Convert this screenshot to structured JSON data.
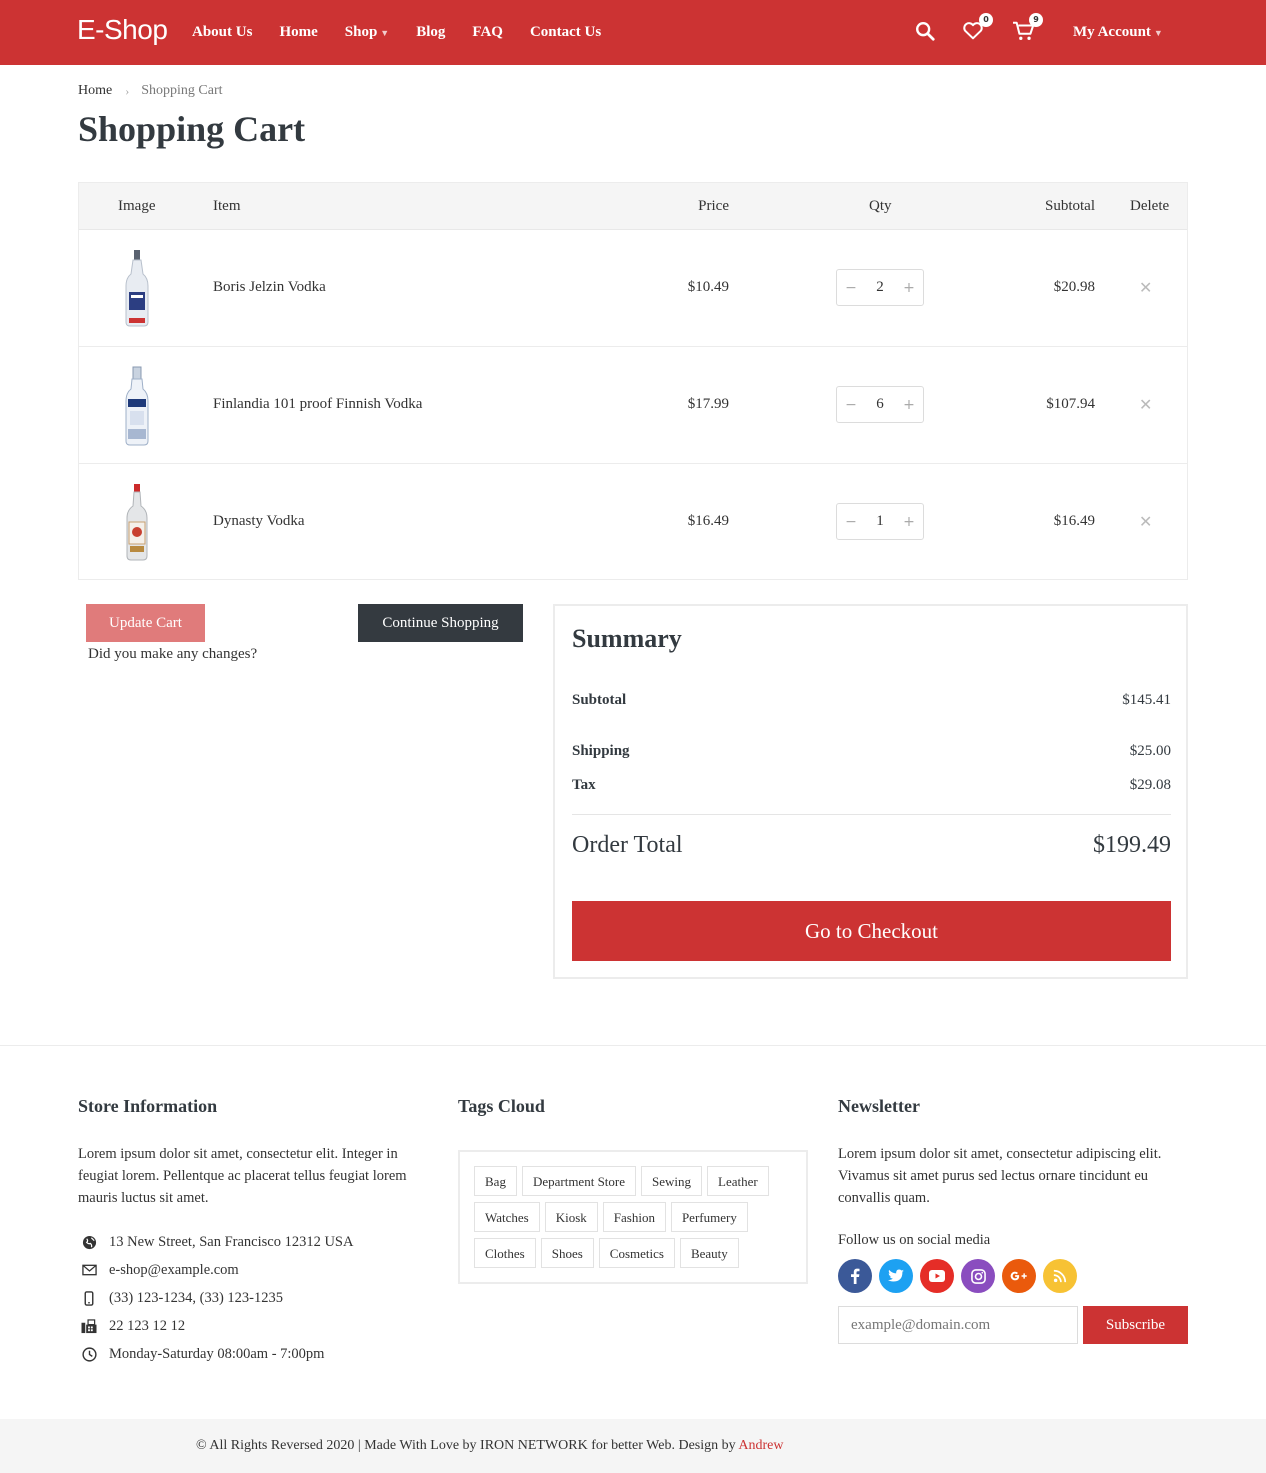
{
  "header": {
    "logo": "E-Shop",
    "nav": [
      "About Us",
      "Home",
      "Shop",
      "Blog",
      "FAQ",
      "Contact Us"
    ],
    "wishlist_count": "0",
    "cart_count": "9",
    "account_label": "My Account",
    "bg_color": "#cc3333"
  },
  "breadcrumb": {
    "home": "Home",
    "current": "Shopping Cart"
  },
  "page_title": "Shopping Cart",
  "cart": {
    "columns": {
      "image": "Image",
      "item": "Item",
      "price": "Price",
      "qty": "Qty",
      "subtotal": "Subtotal",
      "delete": "Delete"
    },
    "items": [
      {
        "name": "Boris Jelzin Vodka",
        "price": "$10.49",
        "qty": "2",
        "subtotal": "$20.98"
      },
      {
        "name": "Finlandia 101 proof Finnish Vodka",
        "price": "$17.99",
        "qty": "6",
        "subtotal": "$107.94"
      },
      {
        "name": "Dynasty Vodka",
        "price": "$16.49",
        "qty": "1",
        "subtotal": "$16.49"
      }
    ],
    "update_label": "Update Cart",
    "changes_note": "Did you make any changes?",
    "continue_label": "Continue Shopping"
  },
  "summary": {
    "title": "Summary",
    "subtotal_label": "Subtotal",
    "subtotal": "$145.41",
    "shipping_label": "Shipping",
    "shipping": "$25.00",
    "tax_label": "Tax",
    "tax": "$29.08",
    "total_label": "Order Total",
    "total": "$199.49",
    "checkout_label": "Go to Checkout"
  },
  "footer": {
    "store": {
      "title": "Store Information",
      "text": "Lorem ipsum dolor sit amet, consectetur elit. Integer in feugiat lorem. Pellentque ac placerat tellus feugiat lorem mauris luctus sit amet.",
      "address": "13 New Street, San Francisco 12312 USA",
      "email": "e-shop@example.com",
      "phone": "(33) 123-1234, (33) 123-1235",
      "fax": "22 123 12 12",
      "hours": "Monday-Saturday 08:00am - 7:00pm"
    },
    "tags": {
      "title": "Tags Cloud",
      "items": [
        "Bag",
        "Department Store",
        "Sewing",
        "Leather",
        "Watches",
        "Kiosk",
        "Fashion",
        "Perfumery",
        "Clothes",
        "Shoes",
        "Cosmetics",
        "Beauty"
      ]
    },
    "newsletter": {
      "title": "Newsletter",
      "text": "Lorem ipsum dolor sit amet, consectetur adipiscing elit. Vivamus sit amet purus sed lectus ornare tincidunt eu convallis quam.",
      "follow_label": "Follow us on social media",
      "socials": [
        {
          "icon": "facebook-icon",
          "color": "#3b5998"
        },
        {
          "icon": "twitter-icon",
          "color": "#1da1f2"
        },
        {
          "icon": "youtube-icon",
          "color": "#e52d27"
        },
        {
          "icon": "instagram-icon",
          "color": "#8a4dbf"
        },
        {
          "icon": "google-plus-icon",
          "color": "#ea5a0c"
        },
        {
          "icon": "rss-icon",
          "color": "#f7c234"
        }
      ],
      "placeholder": "example@domain.com",
      "subscribe_label": "Subscribe"
    },
    "copyright_text": "© All Rights Reversed 2020 | Made With Love by IRON NETWORK for better Web. Design by ",
    "designer": "Andrew"
  }
}
